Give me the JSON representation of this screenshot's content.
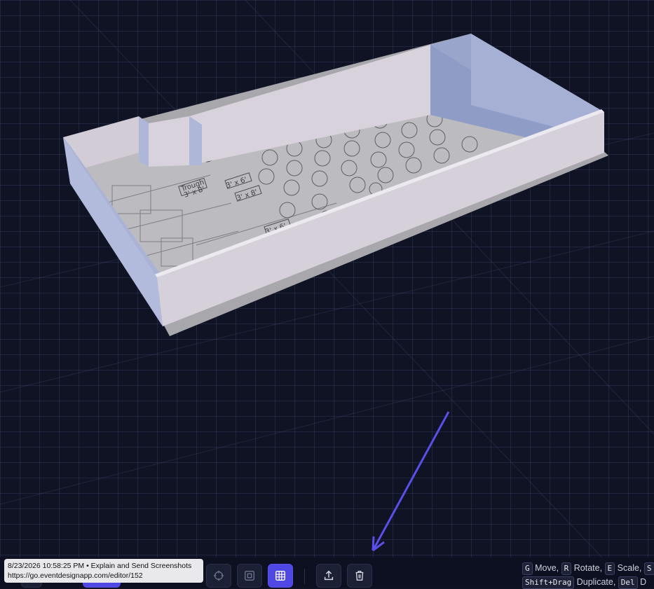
{
  "floorplan": {
    "labels": [
      "3' x 8'",
      "3' x 6'",
      "3' x 8'",
      "3' x 6'",
      "Trough",
      "3' x 8'"
    ]
  },
  "toolbar": {
    "buttons": [
      {
        "name": "target-icon",
        "active": false
      },
      {
        "name": "frame-icon",
        "active": false
      },
      {
        "name": "grid-icon",
        "active": true
      },
      {
        "name": "export-icon",
        "active": false
      },
      {
        "name": "trash-icon",
        "active": false
      }
    ]
  },
  "tooltip": {
    "line1": "8/23/2026 10:58:25 PM • Explain and Send Screenshots",
    "line2": "https://go.eventdesignapp.com/editor/152"
  },
  "shortcuts": {
    "row1": [
      {
        "key": "G",
        "label": "Move,"
      },
      {
        "key": "R",
        "label": "Rotate,"
      },
      {
        "key": "E",
        "label": "Scale,"
      },
      {
        "key": "S",
        "label": ""
      }
    ],
    "row2": [
      {
        "key": "Shift+Drag",
        "label": "Duplicate,"
      },
      {
        "key": "Del",
        "label": "D"
      }
    ]
  },
  "colors": {
    "accent": "#5048e5",
    "background": "#0f1324",
    "wall_light": "#d6d0da",
    "wall_shade": "#9ba6cc",
    "floor": "#b9b9bd"
  }
}
